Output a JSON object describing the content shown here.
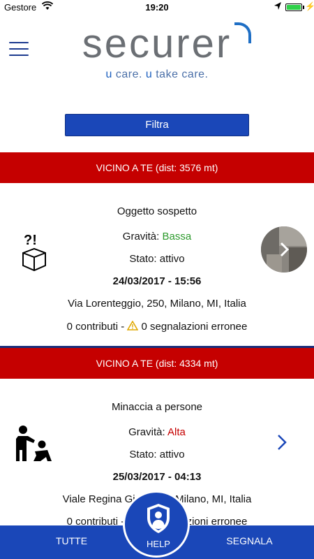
{
  "status_bar": {
    "carrier": "Gestore",
    "time": "19:20"
  },
  "header": {
    "logo_text": "securer",
    "tagline_u1": "u",
    "tagline_part1": " care. ",
    "tagline_u2": "u",
    "tagline_part2": " take care."
  },
  "filter": {
    "label": "Filtra"
  },
  "reports": [
    {
      "header": "VICINO A TE (dist: 3576 mt)",
      "title": "Oggetto sospetto",
      "severity_label": "Gravità: ",
      "severity_value": "Bassa",
      "severity_color": "#2c9a2c",
      "status": "Stato: attivo",
      "datetime": "24/03/2017 - 15:56",
      "address": "Via Lorenteggio, 250, Milano, MI, Italia",
      "contributions": "0 contributi - ",
      "errors": "0 segnalazioni erronee",
      "icon": "suspicious-package-icon",
      "has_photo": true
    },
    {
      "header": "VICINO A TE (dist: 4334 mt)",
      "title": "Minaccia a persone",
      "severity_label": "Gravità: ",
      "severity_value": "Alta",
      "severity_color": "#c50000",
      "status": "Stato: attivo",
      "datetime": "25/03/2017 - 04:13",
      "address": "Viale Regina Giovanna, Milano, MI, Italia",
      "contributions": "0 contributi - ",
      "errors": "0 segnalazioni erronee",
      "icon": "threat-to-people-icon",
      "has_photo": false
    }
  ],
  "tab_bar": {
    "all_label": "TUTTE",
    "help_label": "HELP",
    "report_label": "SEGNALA"
  },
  "colors": {
    "primary_blue": "#1a47b8",
    "alert_red": "#c50000"
  }
}
